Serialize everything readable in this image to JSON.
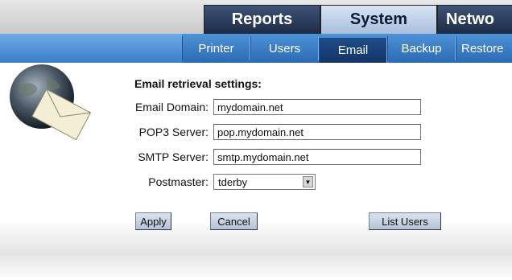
{
  "top_tabs": [
    {
      "label": "Reports",
      "active": false
    },
    {
      "label": "System",
      "active": true
    },
    {
      "label": "Netwo",
      "active": false
    }
  ],
  "sub_tabs": [
    {
      "label": "Printer",
      "active": false
    },
    {
      "label": "Users",
      "active": false
    },
    {
      "label": "Email",
      "active": true
    },
    {
      "label": "Backup",
      "active": false
    },
    {
      "label": "Restore",
      "active": false
    }
  ],
  "form": {
    "heading": "Email retrieval settings:",
    "email_domain": {
      "label": "Email Domain:",
      "value": "mydomain.net"
    },
    "pop3_server": {
      "label": "POP3 Server:",
      "value": "pop.mydomain.net"
    },
    "smtp_server": {
      "label": "SMTP Server:",
      "value": "smtp.mydomain.net"
    },
    "postmaster": {
      "label": "Postmaster:",
      "selected": "tderby"
    }
  },
  "buttons": {
    "apply": "Apply",
    "cancel": "Cancel",
    "list_users": "List Users"
  },
  "icons": {
    "header_art": "globe-envelope-icon",
    "dropdown_arrow": "chevron-down-icon"
  },
  "colors": {
    "nav_dark": "#1d2a45",
    "nav_active": "#a9bfdc",
    "subnav": "#2b6bb4",
    "subnav_active": "#13356a"
  }
}
